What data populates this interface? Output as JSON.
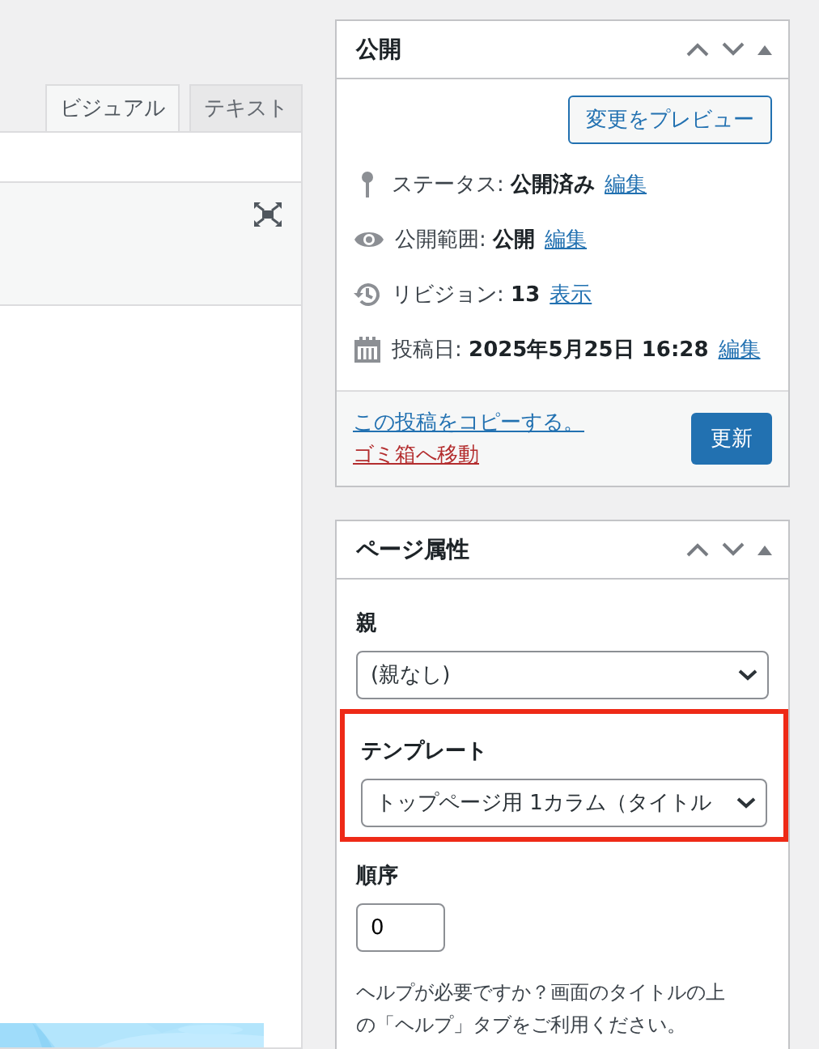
{
  "editor": {
    "tabs": [
      {
        "label": "ビジュアル",
        "selected": true
      },
      {
        "label": "テキスト",
        "selected": false
      }
    ]
  },
  "publish": {
    "title": "公開",
    "preview_button": "変更をプレビュー",
    "rows": [
      {
        "kind": "pin",
        "label": "ステータス:",
        "value": "公開済み",
        "link": "編集"
      },
      {
        "kind": "eye",
        "label": "公開範囲:",
        "value": "公開",
        "link": "編集"
      },
      {
        "kind": "history",
        "label": "リビジョン:",
        "value": "13",
        "link": "表示"
      },
      {
        "kind": "calendar",
        "label": "投稿日:",
        "value": "2025年5月25日 16:28",
        "link": "編集"
      }
    ],
    "copy_link": "この投稿をコピーする。",
    "trash_link": "ゴミ箱へ移動",
    "update_button": "更新"
  },
  "page_attributes": {
    "title": "ページ属性",
    "fields": [
      {
        "kind": "select",
        "label": "親",
        "value": "(親なし)",
        "highlighted": false
      },
      {
        "kind": "select",
        "label": "テンプレート",
        "value": "トップページ用 1カラム（タイトル",
        "highlighted": true
      },
      {
        "kind": "number",
        "label": "順序",
        "value": "0",
        "highlighted": false
      }
    ],
    "help": "ヘルプが必要ですか？画面のタイトルの上の「ヘルプ」タブをご利用ください。"
  }
}
